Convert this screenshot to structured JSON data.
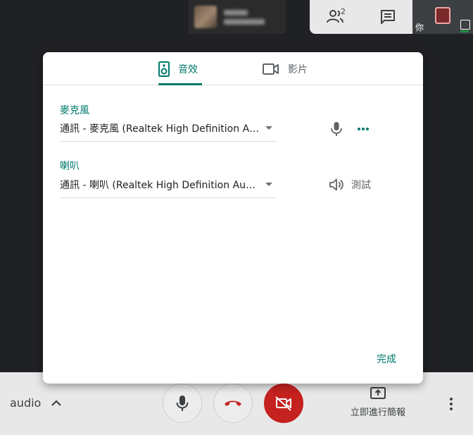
{
  "top_bar": {
    "people_count": "2"
  },
  "self_view": {
    "label": "你"
  },
  "dialog": {
    "tabs": [
      {
        "label": "音效",
        "icon": "speaker-icon",
        "active": true
      },
      {
        "label": "影片",
        "icon": "video-camera-icon",
        "active": false
      }
    ],
    "microphone": {
      "label": "麥克風",
      "selected": "通訊 - 麥克風 (Realtek High Definition Audio)"
    },
    "speaker": {
      "label": "喇叭",
      "selected": "通訊 - 喇叭 (Realtek High Definition Audio)",
      "test_label": "測試"
    },
    "done_label": "完成"
  },
  "bottom_bar": {
    "audio_label": "audio",
    "present_label": "立即進行簡報"
  },
  "colors": {
    "accent": "#00796b",
    "danger": "#c5221f",
    "background": "#202124"
  }
}
